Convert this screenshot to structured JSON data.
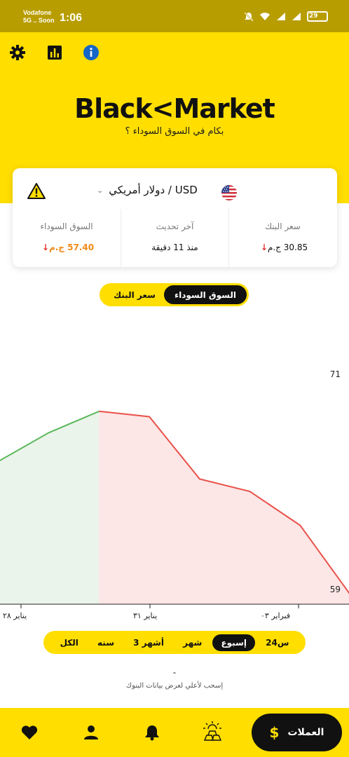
{
  "status_bar": {
    "carrier_line1": "Vodafone",
    "carrier_line2": "5G .. Soon",
    "time": "1:06",
    "battery": "29"
  },
  "header": {
    "icons": [
      "gear-icon",
      "bar-chart-icon",
      "info-icon"
    ],
    "logo_left": "Black",
    "logo_mark": "<",
    "logo_right": "Market",
    "tagline": "بكام في السوق السوداء ؟"
  },
  "currency_card": {
    "currency_label": "دولار أمريكي / USD",
    "bank_rate_label": "سعر البنك",
    "bank_rate_value": "30.85 ج.م",
    "last_update_label": "آخر تحديث",
    "last_update_value": "منذ 11 دقيقة",
    "black_market_label": "السوق السوداء",
    "black_market_value": "57.40 ج.م",
    "colors": {
      "down_arrow": "#e03131",
      "black_market_value": "#f08b16"
    }
  },
  "market_toggle": {
    "active": "السوق السوداء",
    "inactive": "سعر البنك"
  },
  "chart_data": {
    "type": "area",
    "y_ticks": [
      "71",
      "59"
    ],
    "x_tick_labels": [
      "يناير ٢٨",
      "يناير ٣١",
      "فبراير ٠٣"
    ],
    "ylim": [
      59,
      71
    ],
    "points": [
      {
        "x": 0,
        "y": 66.2
      },
      {
        "x": 1,
        "y": 67.8
      },
      {
        "x": 2,
        "y": 69.0
      },
      {
        "x": 3,
        "y": 68.7
      },
      {
        "x": 4,
        "y": 65.2
      },
      {
        "x": 5,
        "y": 64.5
      },
      {
        "x": 6,
        "y": 62.6
      },
      {
        "x": 7,
        "y": 58.7
      }
    ],
    "rising_until_index": 2,
    "colors": {
      "rise_line": "#5cb85c",
      "rise_fill": "#eaf4ea",
      "fall_line": "#e8524a",
      "fall_fill": "#fde6e6"
    },
    "grid": false
  },
  "periods": {
    "items": [
      "24س",
      "إسبوع",
      "شهر",
      "3 أشهر",
      "سنه",
      "الكل"
    ],
    "active": "إسبوع"
  },
  "hint": "إسحب لأعلي لعرض بيانات البنوك",
  "bottom_nav": {
    "primary_label": "العملات",
    "primary_icon": "dollar-icon",
    "items": [
      "gold-icon",
      "bell-icon",
      "user-icon",
      "heart-icon"
    ]
  },
  "colors": {
    "brand_yellow": "#ffde00",
    "dark": "#111111"
  }
}
